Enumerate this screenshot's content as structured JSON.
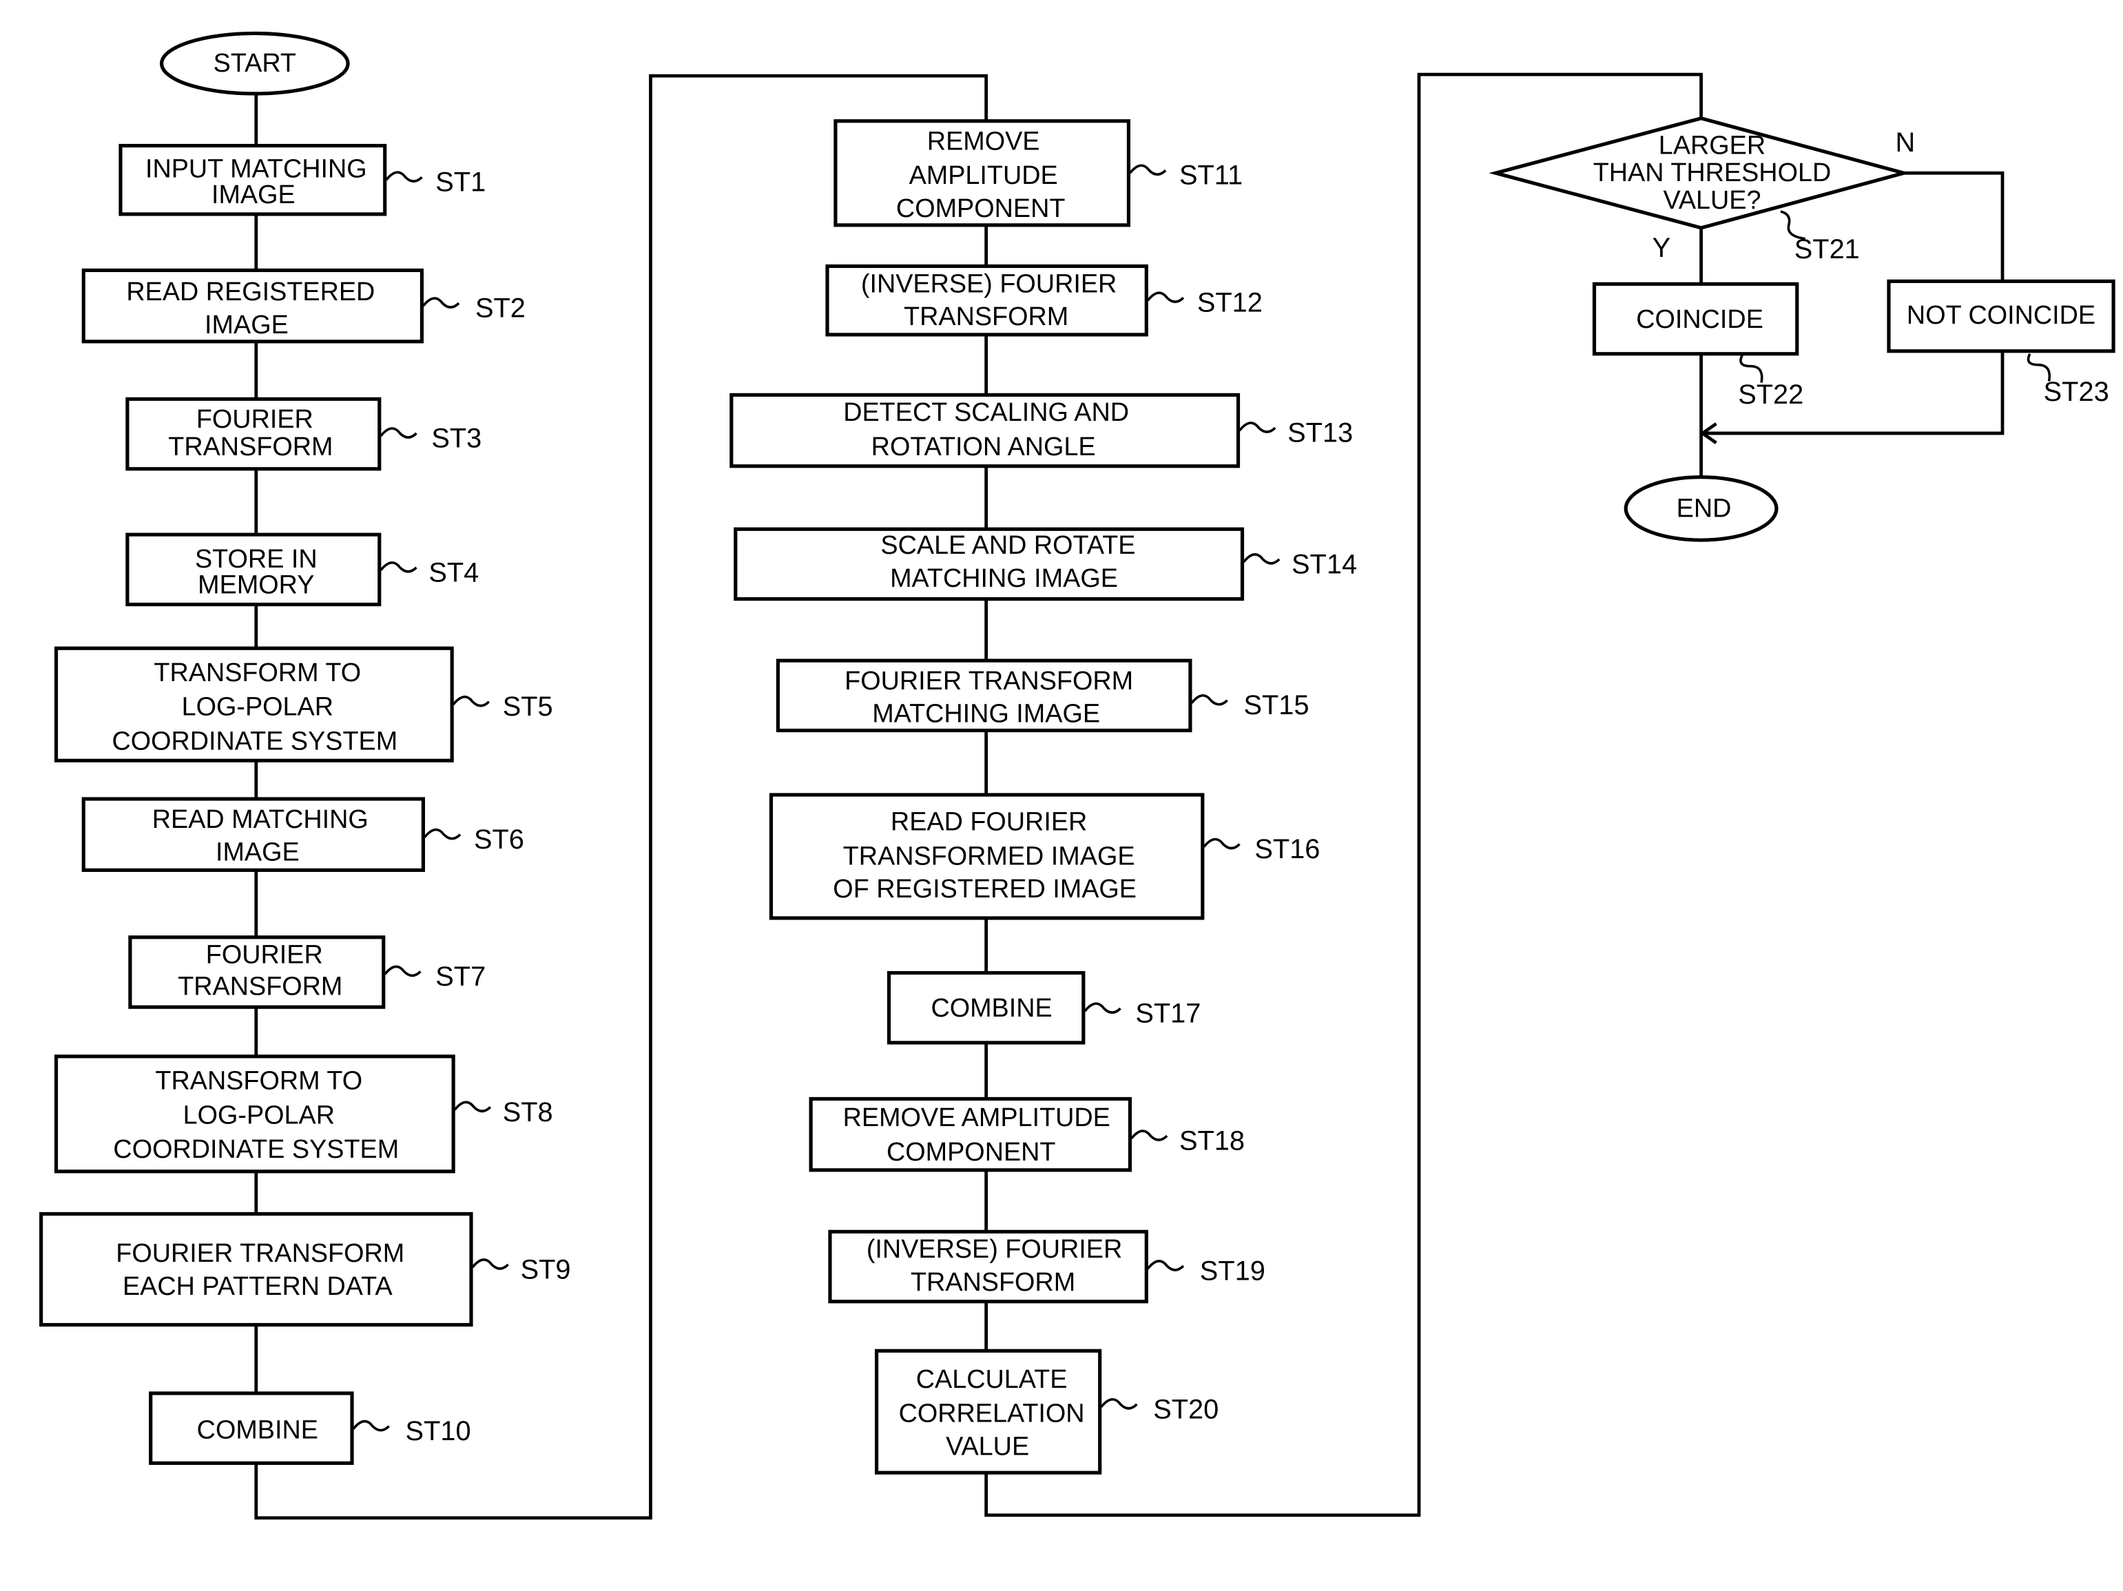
{
  "terminals": {
    "start": "START",
    "end": "END"
  },
  "steps": {
    "st1": {
      "id": "ST1",
      "lines": [
        "INPUT MATCHING",
        "IMAGE"
      ]
    },
    "st2": {
      "id": "ST2",
      "lines": [
        "READ REGISTERED",
        "IMAGE"
      ]
    },
    "st3": {
      "id": "ST3",
      "lines": [
        "FOURIER",
        "TRANSFORM"
      ]
    },
    "st4": {
      "id": "ST4",
      "lines": [
        "STORE IN",
        "MEMORY"
      ]
    },
    "st5": {
      "id": "ST5",
      "lines": [
        "TRANSFORM TO",
        "LOG-POLAR",
        "COORDINATE SYSTEM"
      ]
    },
    "st6": {
      "id": "ST6",
      "lines": [
        "READ MATCHING",
        "IMAGE"
      ]
    },
    "st7": {
      "id": "ST7",
      "lines": [
        "FOURIER",
        "TRANSFORM"
      ]
    },
    "st8": {
      "id": "ST8",
      "lines": [
        "TRANSFORM TO",
        "LOG-POLAR",
        "COORDINATE SYSTEM"
      ]
    },
    "st9": {
      "id": "ST9",
      "lines": [
        "FOURIER TRANSFORM",
        "EACH PATTERN DATA"
      ]
    },
    "st10": {
      "id": "ST10",
      "lines": [
        "COMBINE"
      ]
    },
    "st11": {
      "id": "ST11",
      "lines": [
        "REMOVE",
        "AMPLITUDE",
        "COMPONENT"
      ]
    },
    "st12": {
      "id": "ST12",
      "lines": [
        "(INVERSE) FOURIER",
        "TRANSFORM"
      ]
    },
    "st13": {
      "id": "ST13",
      "lines": [
        "DETECT SCALING AND",
        "ROTATION ANGLE"
      ]
    },
    "st14": {
      "id": "ST14",
      "lines": [
        "SCALE AND ROTATE",
        "MATCHING IMAGE"
      ]
    },
    "st15": {
      "id": "ST15",
      "lines": [
        "FOURIER TRANSFORM",
        "MATCHING IMAGE"
      ]
    },
    "st16": {
      "id": "ST16",
      "lines": [
        "READ FOURIER",
        "TRANSFORMED IMAGE",
        "OF REGISTERED IMAGE"
      ]
    },
    "st17": {
      "id": "ST17",
      "lines": [
        "COMBINE"
      ]
    },
    "st18": {
      "id": "ST18",
      "lines": [
        "REMOVE AMPLITUDE",
        "COMPONENT"
      ]
    },
    "st19": {
      "id": "ST19",
      "lines": [
        "(INVERSE) FOURIER",
        "TRANSFORM"
      ]
    },
    "st20": {
      "id": "ST20",
      "lines": [
        "CALCULATE",
        "CORRELATION",
        "VALUE"
      ]
    },
    "st21": {
      "id": "ST21",
      "lines": [
        "LARGER",
        "THAN THRESHOLD",
        "VALUE?"
      ]
    },
    "st22": {
      "id": "ST22",
      "lines": [
        "COINCIDE"
      ]
    },
    "st23": {
      "id": "ST23",
      "lines": [
        "NOT COINCIDE"
      ]
    }
  },
  "branches": {
    "yes": "Y",
    "no": "N"
  }
}
